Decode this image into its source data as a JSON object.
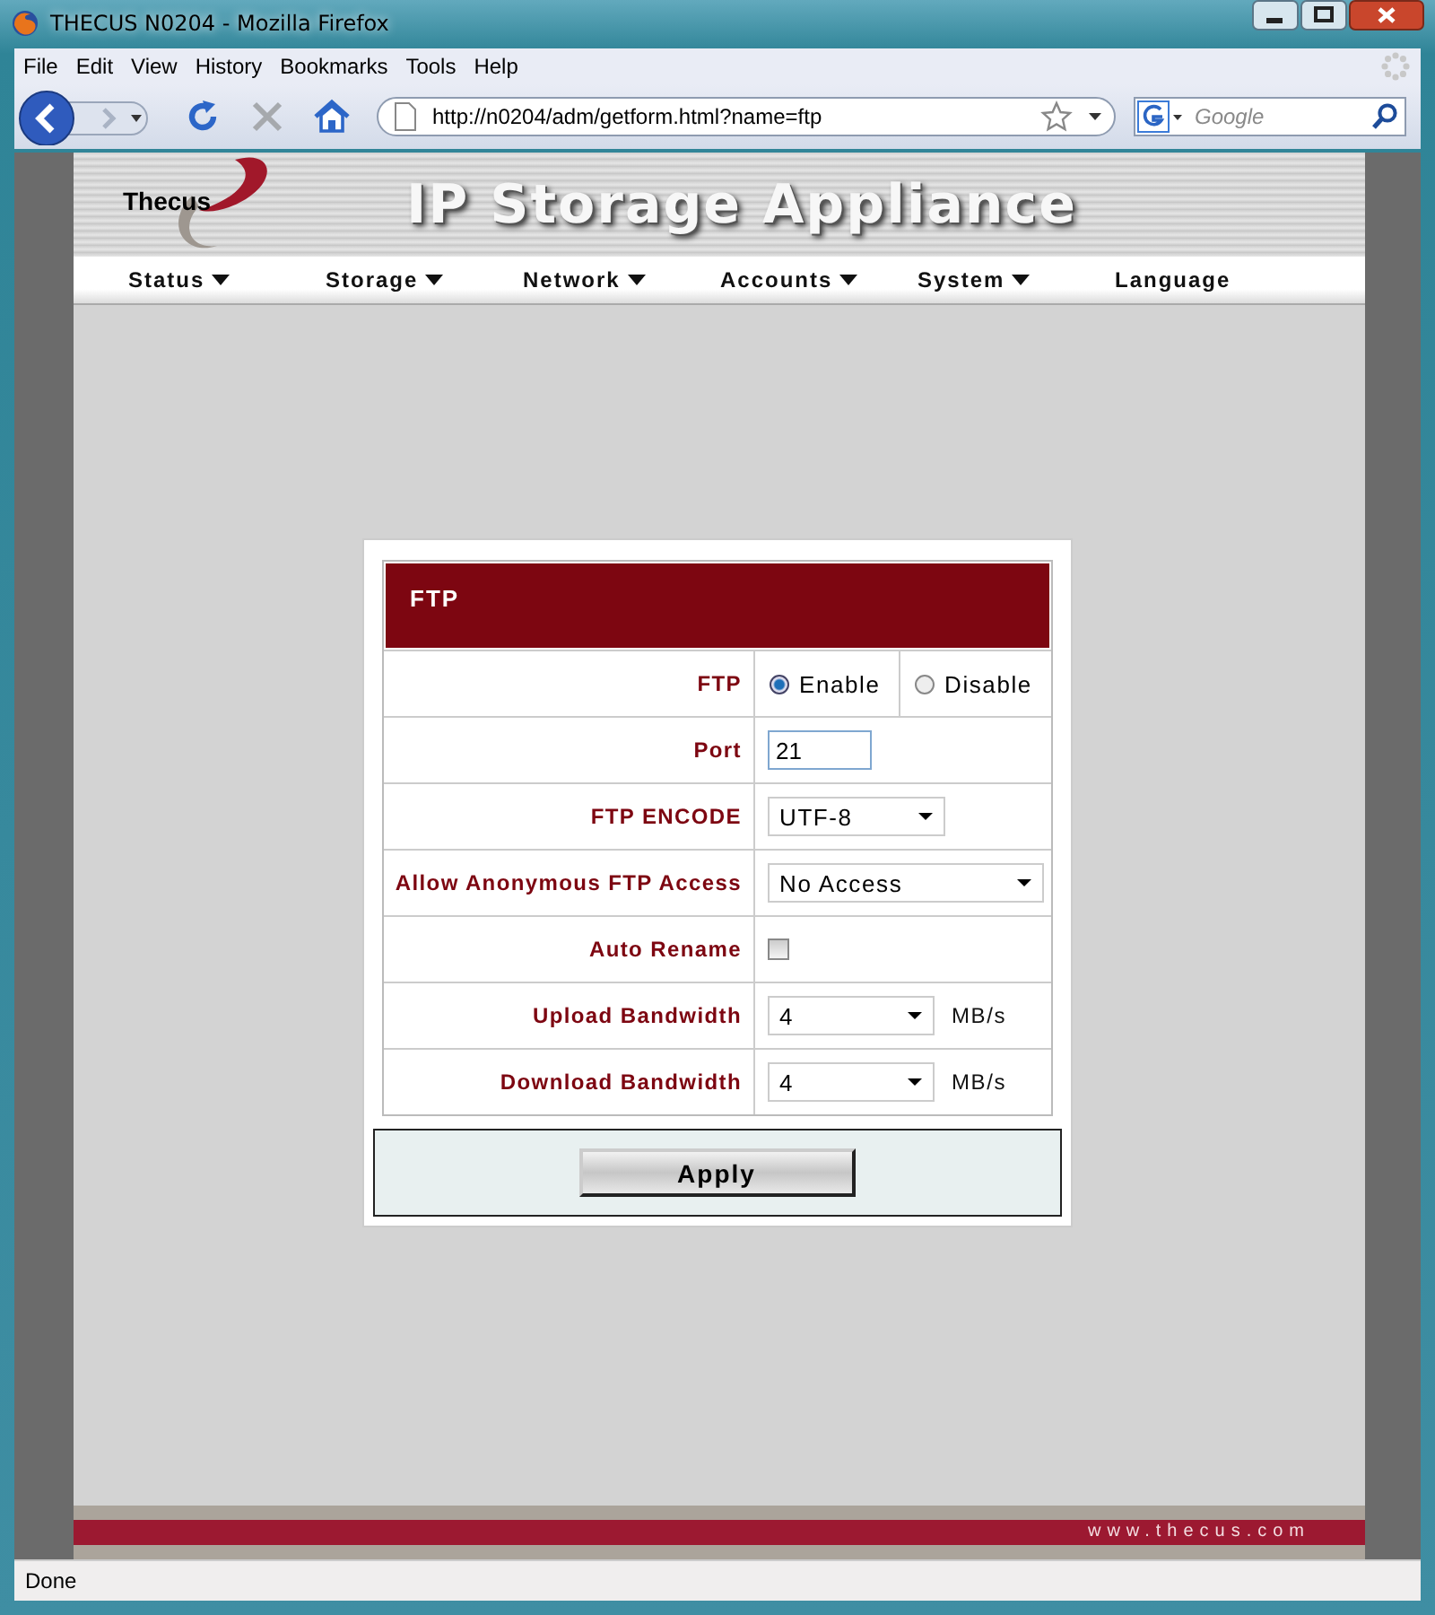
{
  "window": {
    "title": "THECUS N0204 - Mozilla Firefox"
  },
  "menu": [
    {
      "label": "File"
    },
    {
      "label": "Edit"
    },
    {
      "label": "View"
    },
    {
      "label": "History"
    },
    {
      "label": "Bookmarks"
    },
    {
      "label": "Tools"
    },
    {
      "label": "Help"
    }
  ],
  "toolbar": {
    "url": "http://n0204/adm/getform.html?name=ftp",
    "search": {
      "placeholder": "Google"
    }
  },
  "header": {
    "logo": "Thecus",
    "banner": "IP Storage Appliance"
  },
  "nav": [
    {
      "label": "Status",
      "has_menu": true
    },
    {
      "label": "Storage",
      "has_menu": true
    },
    {
      "label": "Network",
      "has_menu": true
    },
    {
      "label": "Accounts",
      "has_menu": true
    },
    {
      "label": "System",
      "has_menu": true
    },
    {
      "label": "Language",
      "has_menu": false
    }
  ],
  "form": {
    "title": "FTP",
    "rows": [
      {
        "kind": "radio",
        "label": "FTP",
        "options": [
          {
            "label": "Enable",
            "selected": true
          },
          {
            "label": "Disable",
            "selected": false
          }
        ]
      },
      {
        "kind": "text",
        "label": "Port",
        "value": "21"
      },
      {
        "kind": "select",
        "label": "FTP ENCODE",
        "value": "UTF-8"
      },
      {
        "kind": "select",
        "label": "Allow Anonymous FTP Access",
        "value": "No Access"
      },
      {
        "kind": "checkbox",
        "label": "Auto Rename",
        "checked": false
      },
      {
        "kind": "select",
        "label": "Upload Bandwidth",
        "value": "4",
        "unit": "MB/s"
      },
      {
        "kind": "select",
        "label": "Download Bandwidth",
        "value": "4",
        "unit": "MB/s"
      }
    ],
    "button": "Apply"
  },
  "footer": "www.thecus.com",
  "status_bar": "Done"
}
